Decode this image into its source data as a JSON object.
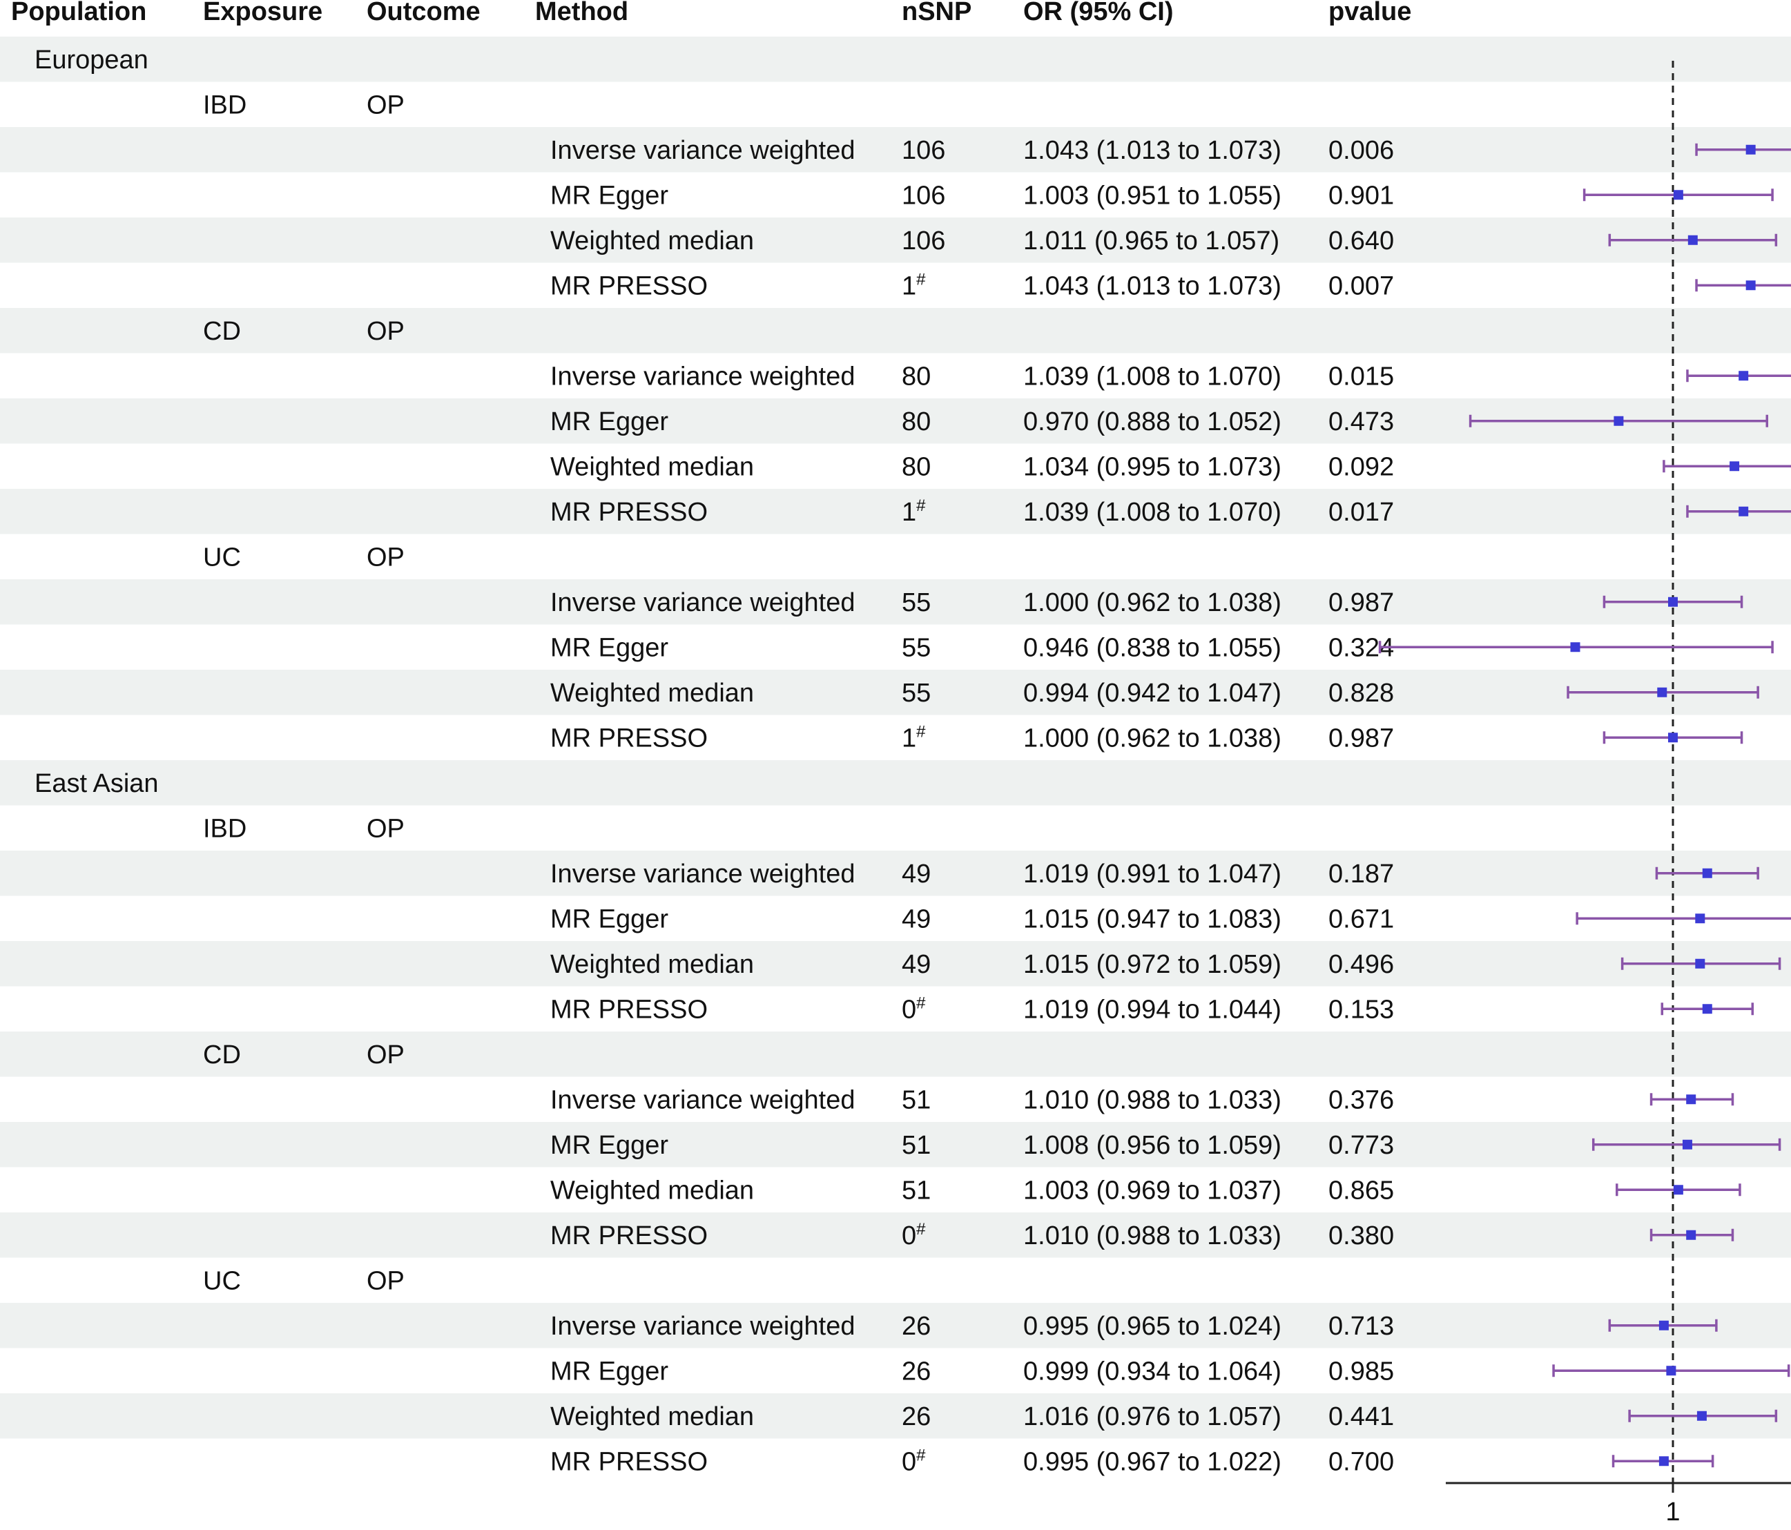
{
  "chart_data": {
    "type": "forest",
    "headers": [
      "Population",
      "Exposure",
      "Outcome",
      "Method",
      "nSNP",
      "OR (95% CI)",
      "pvalue"
    ],
    "reference_line": 1,
    "x_tick_labels": [
      "1"
    ],
    "xlim": [
      0.838,
      1.083
    ],
    "colors": {
      "point": "#3b3bd6",
      "ci": "#8a55a8",
      "stripe": "#eef1f0"
    },
    "rows": [
      {
        "kind": "population",
        "population": "European"
      },
      {
        "kind": "group",
        "exposure": "IBD",
        "outcome": "OP"
      },
      {
        "kind": "result",
        "method": "Inverse variance weighted",
        "nsnp": "106",
        "ci_text": "1.043 (1.013 to 1.073)",
        "pvalue": "0.006",
        "or": 1.043,
        "lo": 1.013,
        "hi": 1.073
      },
      {
        "kind": "result",
        "method": "MR Egger",
        "nsnp": "106",
        "ci_text": "1.003 (0.951 to 1.055)",
        "pvalue": "0.901",
        "or": 1.003,
        "lo": 0.951,
        "hi": 1.055
      },
      {
        "kind": "result",
        "method": "Weighted median",
        "nsnp": "106",
        "ci_text": "1.011 (0.965 to 1.057)",
        "pvalue": "0.640",
        "or": 1.011,
        "lo": 0.965,
        "hi": 1.057
      },
      {
        "kind": "result",
        "method": "MR PRESSO",
        "nsnp": "1",
        "nsnp_mark": "#",
        "ci_text": "1.043 (1.013 to 1.073)",
        "pvalue": "0.007",
        "or": 1.043,
        "lo": 1.013,
        "hi": 1.073
      },
      {
        "kind": "group",
        "exposure": "CD",
        "outcome": "OP"
      },
      {
        "kind": "result",
        "method": "Inverse variance weighted",
        "nsnp": "80",
        "ci_text": "1.039 (1.008 to 1.070)",
        "pvalue": "0.015",
        "or": 1.039,
        "lo": 1.008,
        "hi": 1.07
      },
      {
        "kind": "result",
        "method": "MR Egger",
        "nsnp": "80",
        "ci_text": "0.970 (0.888 to 1.052)",
        "pvalue": "0.473",
        "or": 0.97,
        "lo": 0.888,
        "hi": 1.052
      },
      {
        "kind": "result",
        "method": "Weighted median",
        "nsnp": "80",
        "ci_text": "1.034 (0.995 to 1.073)",
        "pvalue": "0.092",
        "or": 1.034,
        "lo": 0.995,
        "hi": 1.073
      },
      {
        "kind": "result",
        "method": "MR PRESSO",
        "nsnp": "1",
        "nsnp_mark": "#",
        "ci_text": "1.039 (1.008 to 1.070)",
        "pvalue": "0.017",
        "or": 1.039,
        "lo": 1.008,
        "hi": 1.07
      },
      {
        "kind": "group",
        "exposure": "UC",
        "outcome": "OP"
      },
      {
        "kind": "result",
        "method": "Inverse variance weighted",
        "nsnp": "55",
        "ci_text": "1.000 (0.962 to 1.038)",
        "pvalue": "0.987",
        "or": 1.0,
        "lo": 0.962,
        "hi": 1.038
      },
      {
        "kind": "result",
        "method": "MR Egger",
        "nsnp": "55",
        "ci_text": "0.946 (0.838 to 1.055)",
        "pvalue": "0.324",
        "or": 0.946,
        "lo": 0.838,
        "hi": 1.055
      },
      {
        "kind": "result",
        "method": "Weighted median",
        "nsnp": "55",
        "ci_text": "0.994 (0.942 to 1.047)",
        "pvalue": "0.828",
        "or": 0.994,
        "lo": 0.942,
        "hi": 1.047
      },
      {
        "kind": "result",
        "method": "MR PRESSO",
        "nsnp": "1",
        "nsnp_mark": "#",
        "ci_text": "1.000 (0.962 to 1.038)",
        "pvalue": "0.987",
        "or": 1.0,
        "lo": 0.962,
        "hi": 1.038
      },
      {
        "kind": "population",
        "population": "East Asian"
      },
      {
        "kind": "group",
        "exposure": "IBD",
        "outcome": "OP"
      },
      {
        "kind": "result",
        "method": "Inverse variance weighted",
        "nsnp": "49",
        "ci_text": "1.019 (0.991 to 1.047)",
        "pvalue": "0.187",
        "or": 1.019,
        "lo": 0.991,
        "hi": 1.047
      },
      {
        "kind": "result",
        "method": "MR Egger",
        "nsnp": "49",
        "ci_text": "1.015 (0.947 to 1.083)",
        "pvalue": "0.671",
        "or": 1.015,
        "lo": 0.947,
        "hi": 1.083
      },
      {
        "kind": "result",
        "method": "Weighted median",
        "nsnp": "49",
        "ci_text": "1.015 (0.972 to 1.059)",
        "pvalue": "0.496",
        "or": 1.015,
        "lo": 0.972,
        "hi": 1.059
      },
      {
        "kind": "result",
        "method": "MR PRESSO",
        "nsnp": "0",
        "nsnp_mark": "#",
        "ci_text": "1.019 (0.994 to 1.044)",
        "pvalue": "0.153",
        "or": 1.019,
        "lo": 0.994,
        "hi": 1.044
      },
      {
        "kind": "group",
        "exposure": "CD",
        "outcome": "OP"
      },
      {
        "kind": "result",
        "method": "Inverse variance weighted",
        "nsnp": "51",
        "ci_text": "1.010 (0.988 to 1.033)",
        "pvalue": "0.376",
        "or": 1.01,
        "lo": 0.988,
        "hi": 1.033
      },
      {
        "kind": "result",
        "method": "MR Egger",
        "nsnp": "51",
        "ci_text": "1.008 (0.956 to 1.059)",
        "pvalue": "0.773",
        "or": 1.008,
        "lo": 0.956,
        "hi": 1.059
      },
      {
        "kind": "result",
        "method": "Weighted median",
        "nsnp": "51",
        "ci_text": "1.003 (0.969 to 1.037)",
        "pvalue": "0.865",
        "or": 1.003,
        "lo": 0.969,
        "hi": 1.037
      },
      {
        "kind": "result",
        "method": "MR PRESSO",
        "nsnp": "0",
        "nsnp_mark": "#",
        "ci_text": "1.010 (0.988 to 1.033)",
        "pvalue": "0.380",
        "or": 1.01,
        "lo": 0.988,
        "hi": 1.033
      },
      {
        "kind": "group",
        "exposure": "UC",
        "outcome": "OP"
      },
      {
        "kind": "result",
        "method": "Inverse variance weighted",
        "nsnp": "26",
        "ci_text": "0.995 (0.965 to 1.024)",
        "pvalue": "0.713",
        "or": 0.995,
        "lo": 0.965,
        "hi": 1.024
      },
      {
        "kind": "result",
        "method": "MR Egger",
        "nsnp": "26",
        "ci_text": "0.999 (0.934 to 1.064)",
        "pvalue": "0.985",
        "or": 0.999,
        "lo": 0.934,
        "hi": 1.064
      },
      {
        "kind": "result",
        "method": "Weighted median",
        "nsnp": "26",
        "ci_text": "1.016 (0.976 to 1.057)",
        "pvalue": "0.441",
        "or": 1.016,
        "lo": 0.976,
        "hi": 1.057
      },
      {
        "kind": "result",
        "method": "MR PRESSO",
        "nsnp": "0",
        "nsnp_mark": "#",
        "ci_text": "0.995 (0.967 to 1.022)",
        "pvalue": "0.700",
        "or": 0.995,
        "lo": 0.967,
        "hi": 1.022
      }
    ]
  }
}
